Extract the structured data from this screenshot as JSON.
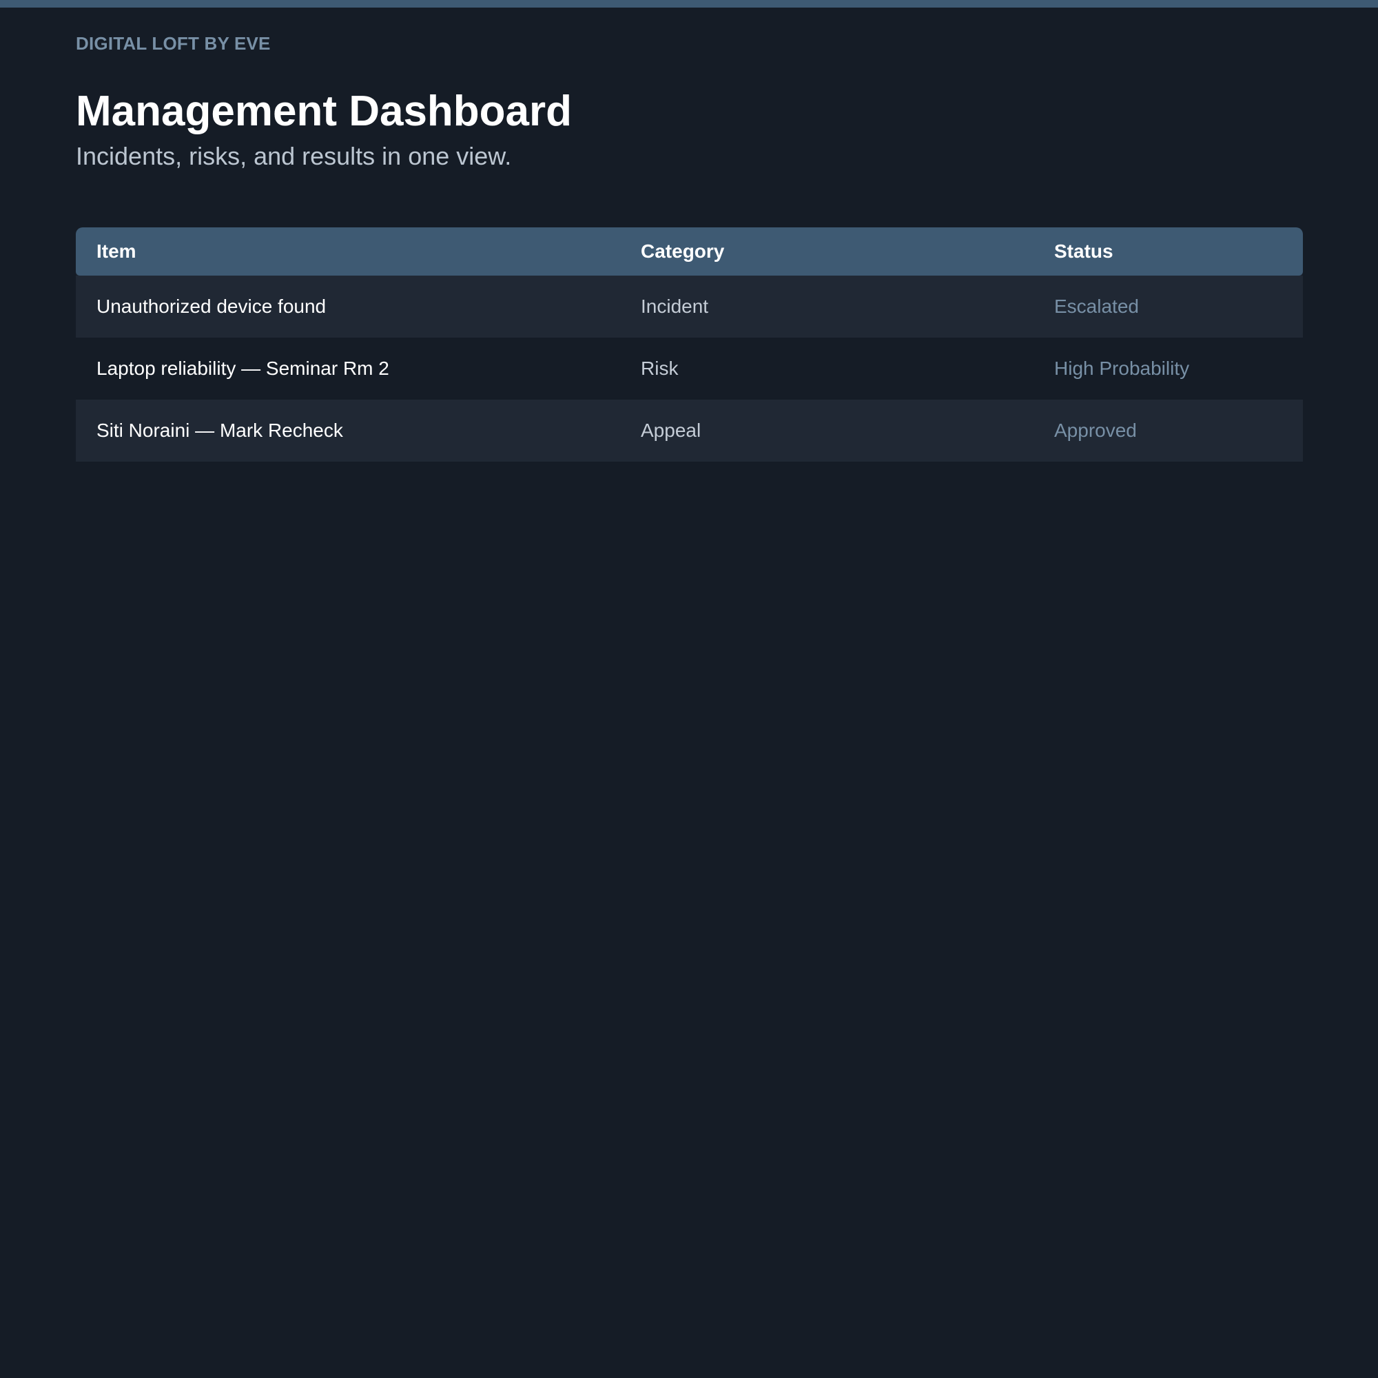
{
  "brand": "DIGITAL LOFT BY EVE",
  "page_title": "Management Dashboard",
  "subtitle": "Incidents, risks, and results in one view.",
  "table": {
    "headers": {
      "item": "Item",
      "category": "Category",
      "status": "Status"
    },
    "rows": [
      {
        "item": "Unauthorized device found",
        "category": "Incident",
        "status": "Escalated"
      },
      {
        "item": "Laptop reliability — Seminar Rm 2",
        "category": "Risk",
        "status": "High Probability"
      },
      {
        "item": "Siti Noraini — Mark Recheck",
        "category": "Appeal",
        "status": "Approved"
      }
    ]
  },
  "colors": {
    "background": "#151c26",
    "accent": "#3e5a73",
    "row_alt": "#202834",
    "muted_text": "#7890a6"
  }
}
